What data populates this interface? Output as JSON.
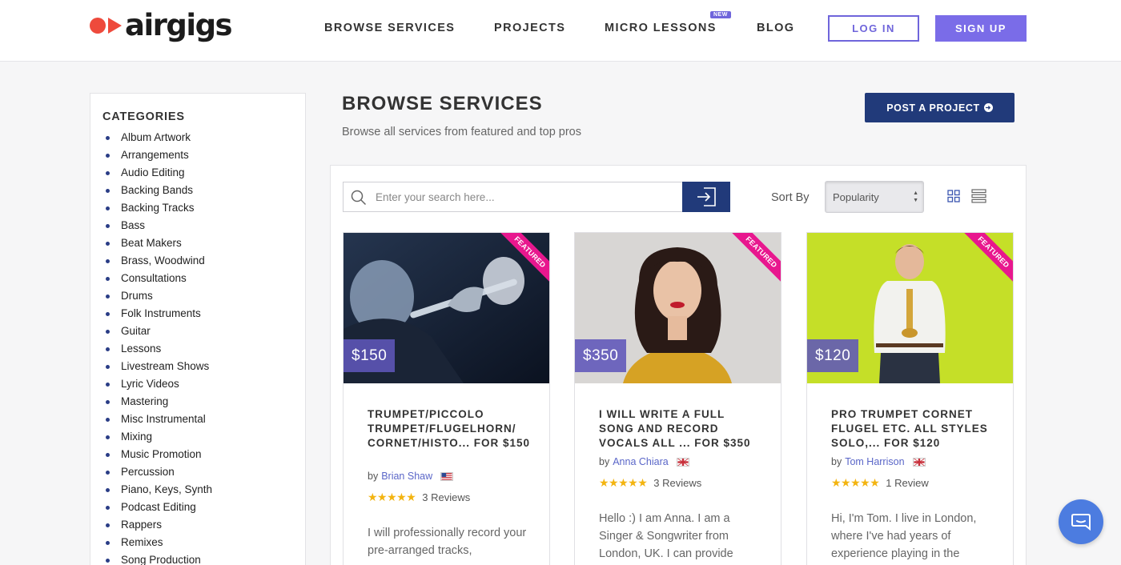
{
  "brand": {
    "name": "airgigs",
    "color": "#ee4a3c"
  },
  "nav": {
    "items": [
      "BROWSE SERVICES",
      "PROJECTS",
      "MICRO LESSONS",
      "BLOG"
    ],
    "new_badge": "NEW",
    "login": "LOG IN",
    "signup": "SIGN UP"
  },
  "sidebar": {
    "title": "CATEGORIES",
    "items": [
      "Album Artwork",
      "Arrangements",
      "Audio Editing",
      "Backing Bands",
      "Backing Tracks",
      "Bass",
      "Beat Makers",
      "Brass, Woodwind",
      "Consultations",
      "Drums",
      "Folk Instruments",
      "Guitar",
      "Lessons",
      "Livestream Shows",
      "Lyric Videos",
      "Mastering",
      "Misc Instrumental",
      "Mixing",
      "Music Promotion",
      "Percussion",
      "Piano, Keys, Synth",
      "Podcast Editing",
      "Rappers",
      "Remixes",
      "Song Production"
    ]
  },
  "main": {
    "title": "BROWSE SERVICES",
    "subtitle": "Browse all services from featured and top pros",
    "post_button": "POST A PROJECT",
    "search_placeholder": "Enter your search here...",
    "sort_label": "Sort By",
    "sort_value": "Popularity"
  },
  "cards": [
    {
      "price": "$150",
      "ribbon": "FEATURED",
      "title": "TRUMPET/PICCOLO TRUMPET/FLUGELHORN/ CORNET/HISTO... FOR $150",
      "by": "by",
      "seller": "Brian Shaw",
      "flag": "us-flag",
      "rating": 5,
      "reviews": "3  Reviews",
      "desc": "I will professionally record your pre-arranged tracks,"
    },
    {
      "price": "$350",
      "ribbon": "FEATURED",
      "title": "I WILL WRITE A FULL SONG AND RECORD VOCALS ALL ... FOR $350",
      "by": "by",
      "seller": "Anna Chiara",
      "flag": "uk-flag",
      "rating": 5,
      "reviews": "3  Reviews",
      "desc": "Hello :) I am Anna. I am a Singer & Songwriter from London, UK. I can provide"
    },
    {
      "price": "$120",
      "ribbon": "FEATURED",
      "title": "PRO TRUMPET CORNET FLUGEL ETC. ALL STYLES SOLO,... FOR $120",
      "by": "by",
      "seller": "Tom Harrison",
      "flag": "uk-flag",
      "rating": 5,
      "reviews": "1  Review",
      "desc": "Hi, I'm Tom. I live in London, where I've had years of experience playing in the"
    }
  ],
  "colors": {
    "accent": "#6f65db",
    "navy": "#213a7a",
    "featured": "#e8178e",
    "chat": "#4c7ce0"
  }
}
